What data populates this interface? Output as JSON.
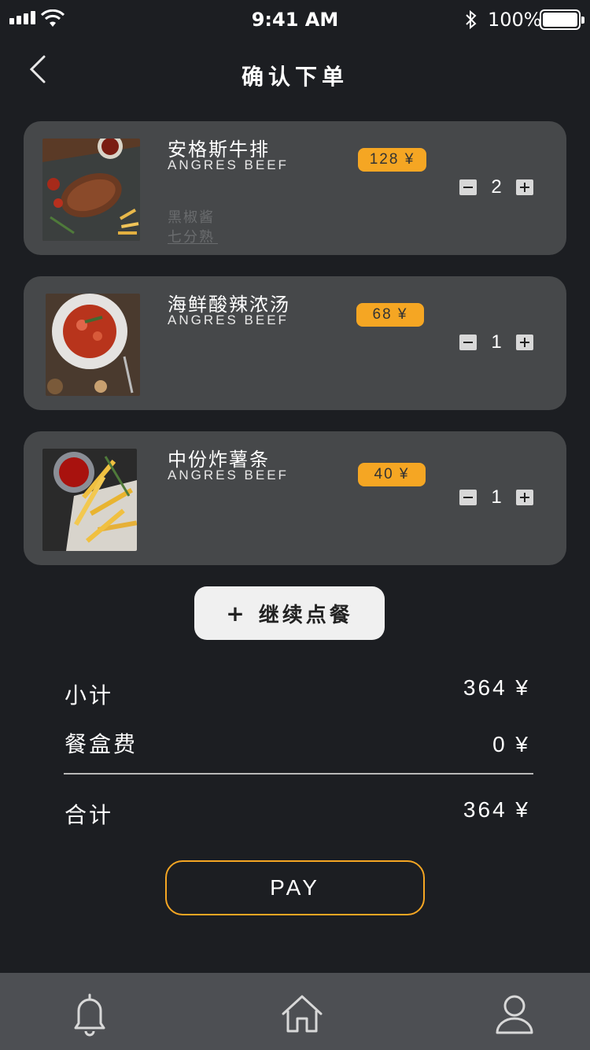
{
  "status": {
    "time": "9:41 AM",
    "battery": "100%"
  },
  "nav": {
    "title": "确认下单",
    "back_icon": "chevron-left-icon"
  },
  "items": [
    {
      "name": "安格斯牛排",
      "subtitle": "ANGRES BEEF",
      "price": "128 ¥",
      "qty": "2",
      "options": [
        "黑椒酱",
        "七分熟"
      ]
    },
    {
      "name": "海鲜酸辣浓汤",
      "subtitle": "ANGRES BEEF",
      "price": "68 ¥",
      "qty": "1"
    },
    {
      "name": "中份炸薯条",
      "subtitle": "ANGRES BEEF",
      "price": "40 ¥",
      "qty": "1"
    }
  ],
  "continue": {
    "icon": "+",
    "label": "继续点餐"
  },
  "summary": {
    "subtotal_label": "小计",
    "subtotal_value": "364 ¥",
    "box_label": "餐盒费",
    "box_value": "0 ¥",
    "total_label": "合计",
    "total_value": "364 ¥"
  },
  "pay_label": "PAY",
  "tabbar": {
    "items": [
      "bell-icon",
      "home-icon",
      "user-icon"
    ]
  },
  "colors": {
    "accent": "#f5a623",
    "background": "#1c1e22",
    "card": "#46484a",
    "tabbar": "#4d4f53"
  }
}
